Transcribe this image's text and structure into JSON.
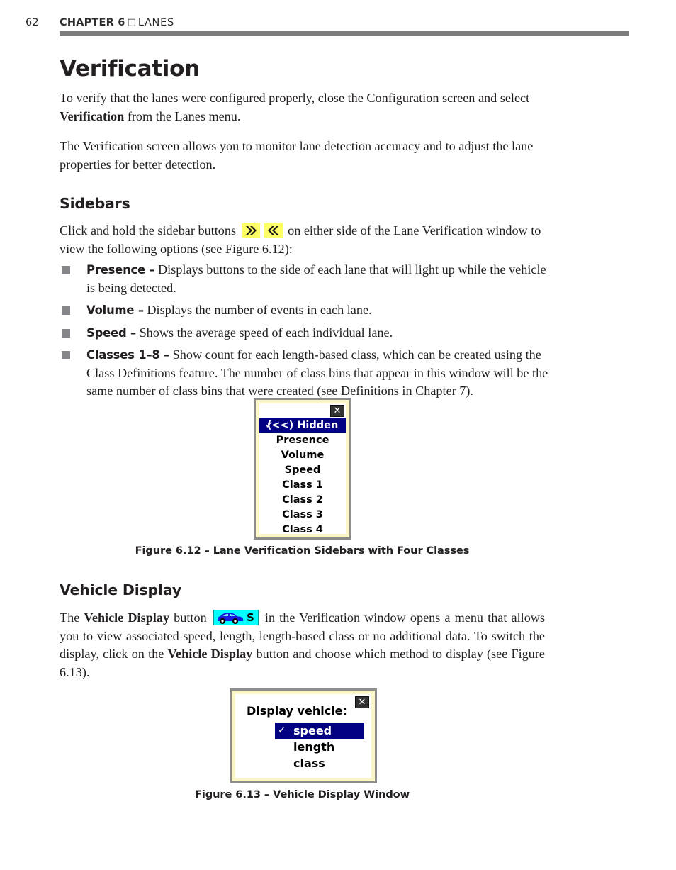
{
  "page": {
    "folio": "62",
    "chapter_bold": "CHAPTER 6",
    "chapter_separator": "□",
    "chapter_rest": "LANES"
  },
  "sections": {
    "verification": {
      "heading": "Verification",
      "para1_part1": "To verify that the lanes were configured properly, close the Configuration screen and select ",
      "para1_bold": "Verification",
      "para1_part2": " from the Lanes menu.",
      "para2": "The Verification screen allows you to monitor lane detection accuracy and to adjust the lane properties for better detection."
    },
    "sidebars": {
      "heading": "Sidebars",
      "intro_part1": "Click and hold the sidebar buttons ",
      "intro_part2": " on either side of the Lane Verification window to view the following options (see Figure 6.12):",
      "icon_forward": "double-chevron-right-icon",
      "icon_back": "double-chevron-left-icon",
      "bullets": [
        {
          "lead": "Presence –",
          "text": " Displays buttons to the side of each lane that will light up while the vehicle is being detected."
        },
        {
          "lead": "Volume –",
          "text": " Displays the number of events in each lane."
        },
        {
          "lead": "Speed –",
          "text": " Shows the average speed of each individual lane."
        },
        {
          "lead": "Classes 1–8 –",
          "text": " Show count for each length-based class, which can be created using the Class Definitions feature. The number of class bins that appear in this window will be the same number of class bins that were created (see Definitions in Chapter 7)."
        }
      ]
    },
    "vehicle_display": {
      "heading": "Vehicle Display",
      "para_part1": "The ",
      "para_bold1": "Vehicle Display",
      "para_part2": " button ",
      "para_part3": " in the Verification window opens a menu that allows you to view associated speed, length, length-based class or no additional data. To switch the display, click on the ",
      "para_bold2": "Vehicle Display",
      "para_part4": " button and choose which method to display (see Figure 6.13).",
      "button_icon": "vehicle-display-car-speed-icon",
      "button_icon_letter": "S"
    }
  },
  "figure_612": {
    "caption": "Figure 6.12 – Lane Verification Sidebars with Four Classes",
    "close_label": "✕",
    "check_glyph": "✓",
    "items": [
      {
        "label": "(<<) Hidden",
        "selected": true
      },
      {
        "label": "Presence",
        "selected": false
      },
      {
        "label": "Volume",
        "selected": false
      },
      {
        "label": "Speed",
        "selected": false
      },
      {
        "label": "Class 1",
        "selected": false
      },
      {
        "label": "Class 2",
        "selected": false
      },
      {
        "label": "Class 3",
        "selected": false
      },
      {
        "label": "Class 4",
        "selected": false
      }
    ]
  },
  "figure_613": {
    "caption": "Figure 6.13 – Vehicle Display Window",
    "title": "Display vehicle:",
    "close_label": "✕",
    "check_glyph": "✓",
    "items": [
      {
        "label": "speed",
        "selected": true
      },
      {
        "label": "length",
        "selected": false
      },
      {
        "label": "class",
        "selected": false
      }
    ]
  },
  "colors": {
    "rule_gray": "#7d7b7c",
    "bullet_gray": "#86858a",
    "menu_highlight": "#000080",
    "menu_border_cream": "#fbf6c8",
    "sidebar_button_yellow": "#ffff66",
    "vehicle_button_cyan": "#00ffff",
    "vehicle_car_blue": "#1b1be0"
  }
}
